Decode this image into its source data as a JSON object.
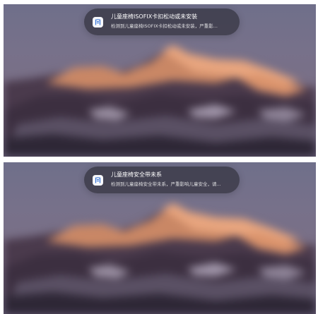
{
  "screens": [
    {
      "notification": {
        "app_icon": "child-seat-app-icon",
        "title": "儿童座椅ISOFIX卡扣松动或未安装",
        "body": "检测到儿童座椅ISOFIX卡扣松动或未安装，严重影..."
      }
    },
    {
      "notification": {
        "app_icon": "child-seat-app-icon",
        "title": "儿童座椅安全带未系",
        "body": "检测到儿童座椅安全带未系，严重影响儿童安全，请..."
      }
    }
  ],
  "colors": {
    "notification_background": "#282832",
    "wallpaper_sky": "#74708a",
    "peak_glow": "#d98a5a"
  }
}
